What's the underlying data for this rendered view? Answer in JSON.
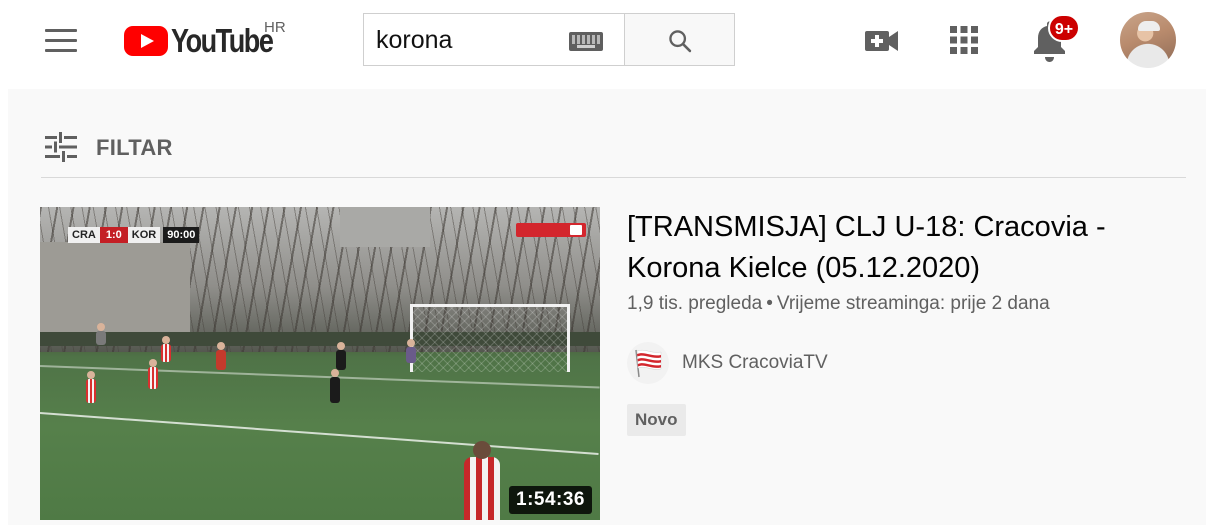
{
  "header": {
    "logo_text": "YouTube",
    "region": "HR",
    "search": {
      "value": "korona"
    },
    "notifications_badge": "9+",
    "icons": [
      "menu-icon",
      "keyboard-icon",
      "search-icon",
      "create-video-icon",
      "apps-icon",
      "bell-icon"
    ]
  },
  "filter": {
    "label": "FILTAR",
    "icon": "filter-sliders-icon"
  },
  "result": {
    "title": "[TRANSMISJA] CLJ U-18: Cracovia - Korona Kielce (05.12.2020)",
    "views": "1,9 tis. pregleda",
    "separator": "•",
    "streamed": "Vrijeme streaminga: prije 2 dana",
    "channel": "MKS CracoviaTV",
    "badge": "Novo",
    "duration": "1:54:36",
    "thumbnail": {
      "home_team": "CRA",
      "score": "1:0",
      "away_team": "KOR",
      "clock": "90:00"
    }
  },
  "colors": {
    "brand_red": "#ff0000",
    "notification_red": "#cc0000",
    "secondary_text": "#606060",
    "content_background": "#f9f9f9"
  }
}
